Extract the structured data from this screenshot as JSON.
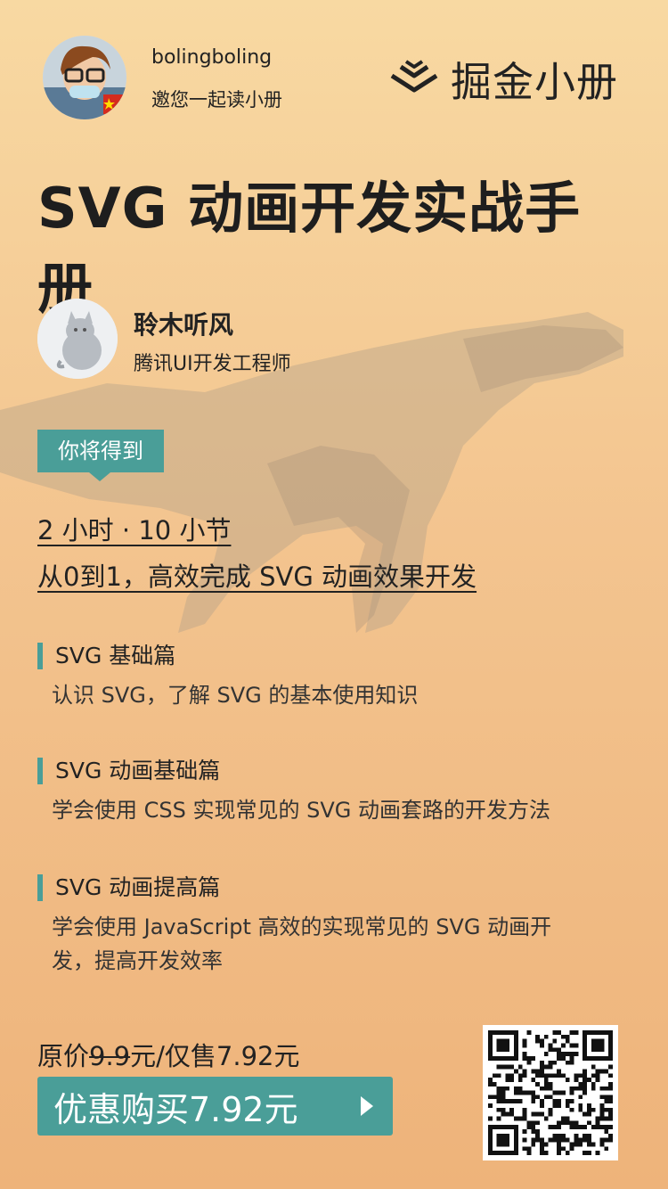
{
  "header": {
    "username": "bolingboling",
    "invite_text": "邀您一起读小册",
    "brand_name": "掘金小册"
  },
  "book": {
    "title": "SVG 动画开发实战手册"
  },
  "author": {
    "name": "聆木听风",
    "title": "腾讯UI开发工程师"
  },
  "gain": {
    "tag_label": "你将得到",
    "line1": "2 小时 · 10 小节",
    "line2": "从0到1，高效完成 SVG 动画效果开发"
  },
  "sections": [
    {
      "title": "SVG 基础篇",
      "desc": "认识 SVG，了解 SVG 的基本使用知识"
    },
    {
      "title": "SVG 动画基础篇",
      "desc": "学会使用 CSS 实现常见的 SVG 动画套路的开发方法"
    },
    {
      "title": "SVG 动画提高篇",
      "desc": "学会使用 JavaScript 高效的实现常见的 SVG 动画开发，提高开发效率"
    }
  ],
  "price": {
    "original_label": "原价",
    "original_value": "9.9",
    "unit": "元",
    "sale_text": "/仅售7.92元"
  },
  "buy_button": {
    "label": "优惠购买7.92元"
  },
  "colors": {
    "accent": "#4a9e98",
    "background_top": "#f8d9a2",
    "background_bottom": "#eeb37a"
  }
}
